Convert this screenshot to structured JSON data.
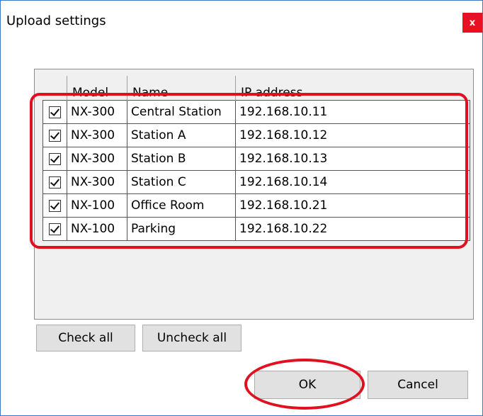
{
  "dialog": {
    "title": "Upload settings",
    "close_label": "x"
  },
  "columns": {
    "model": "Model",
    "name": "Name",
    "ip": "IP address"
  },
  "rows": [
    {
      "checked": true,
      "model": "NX-300",
      "name": "Central Station",
      "ip": "192.168.10.11"
    },
    {
      "checked": true,
      "model": "NX-300",
      "name": "Station A",
      "ip": "192.168.10.12"
    },
    {
      "checked": true,
      "model": "NX-300",
      "name": "Station B",
      "ip": "192.168.10.13"
    },
    {
      "checked": true,
      "model": "NX-300",
      "name": "Station C",
      "ip": "192.168.10.14"
    },
    {
      "checked": true,
      "model": "NX-100",
      "name": "Office Room",
      "ip": "192.168.10.21"
    },
    {
      "checked": true,
      "model": "NX-100",
      "name": "Parking",
      "ip": "192.168.10.22"
    }
  ],
  "buttons": {
    "check_all": "Check all",
    "uncheck_all": "Uncheck all",
    "ok": "OK",
    "cancel": "Cancel"
  },
  "colors": {
    "highlight": "#e0101e",
    "close_bg": "#e81123",
    "button_bg": "#e1e1e1"
  }
}
